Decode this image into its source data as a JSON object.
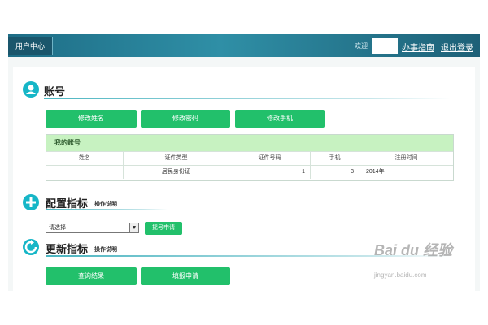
{
  "topbar": {
    "brand": "用户中心",
    "welcome": "欢迎",
    "links": [
      "办事指南",
      "退出登录"
    ]
  },
  "account": {
    "title": "账号",
    "buttons": [
      "修改姓名",
      "修改密码",
      "修改手机"
    ],
    "table": {
      "title": "我的账号",
      "columns": [
        "姓名",
        "证件类型",
        "证件号码",
        "手机",
        "注册时间"
      ],
      "rows": [
        [
          "",
          "居民身份证",
          "1",
          "3",
          "2014年"
        ]
      ]
    }
  },
  "config": {
    "title": "配置指标",
    "sub": "操作说明",
    "select_value": "请选择",
    "apply_label": "摇号申请"
  },
  "update": {
    "title": "更新指标",
    "sub": "操作说明",
    "buttons": [
      "查询结果",
      "填报申请"
    ]
  },
  "watermark": {
    "brand": "Bai du 经验",
    "url": "jingyan.baidu.com"
  },
  "colors": {
    "topbar": "#1e6d86",
    "button": "#22c06b",
    "table_header": "#c7f2c1",
    "section_icon": "#16b6c7"
  }
}
